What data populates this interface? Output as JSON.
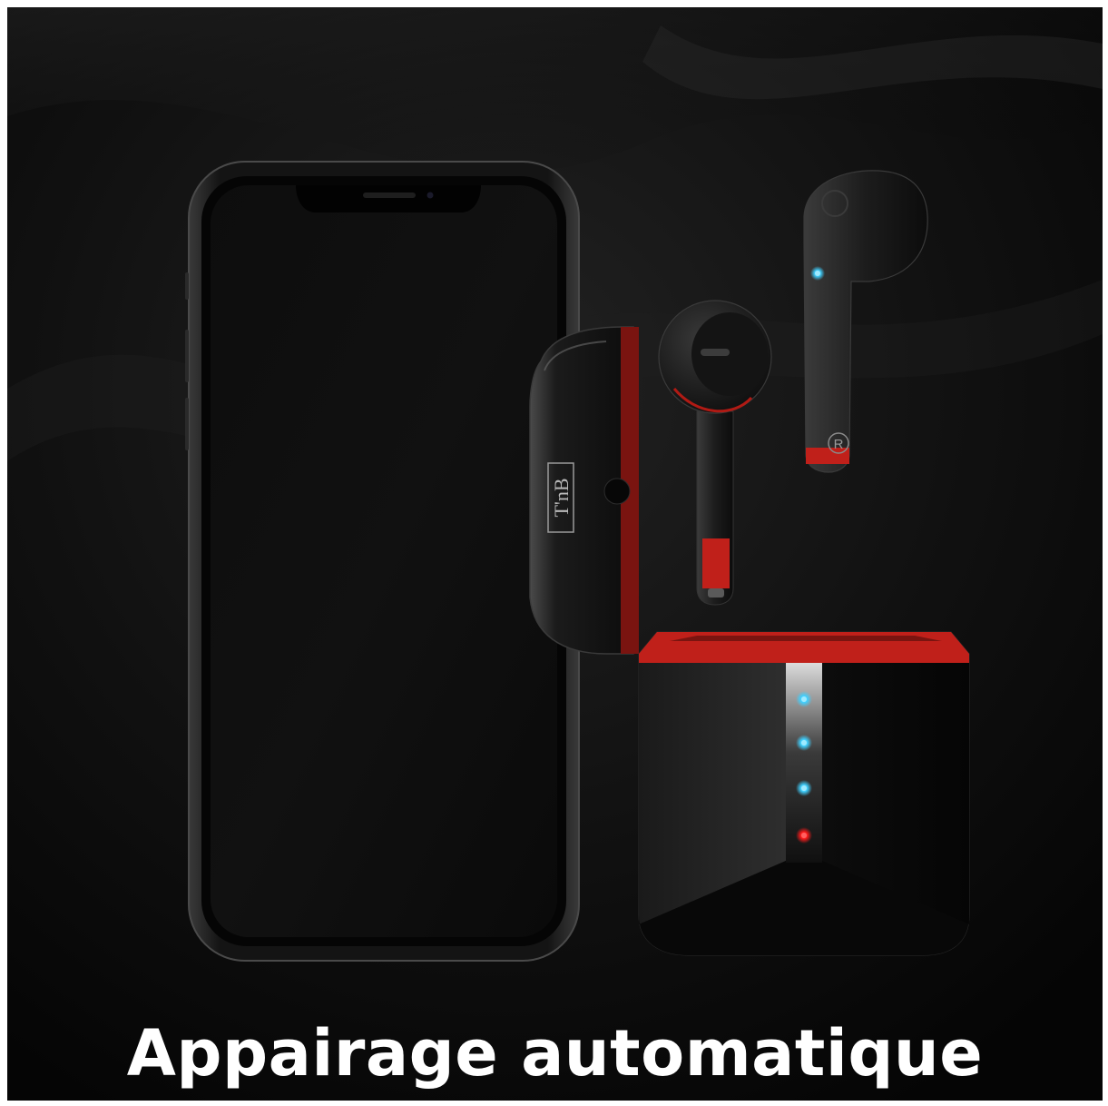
{
  "caption": "Appairage automatique",
  "brand_logo_text": "T'nB",
  "earbud_marking": "R",
  "colors": {
    "background": "#070707",
    "accent_red": "#c0201a",
    "led_blue": "#3fd0ff",
    "led_red": "#ff1a1a",
    "caption_text": "#ffffff"
  },
  "case_led_states": [
    "blue",
    "blue",
    "blue",
    "red"
  ]
}
